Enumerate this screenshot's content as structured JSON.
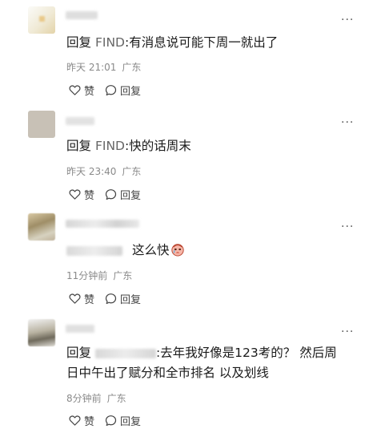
{
  "actions": {
    "like_label": "赞",
    "reply_label": "回复"
  },
  "comments": [
    {
      "reply_prefix": "回复",
      "reply_target": "FIND",
      "text": ":有消息说可能下周一就出了",
      "date": "昨天 21:01",
      "location": "广东"
    },
    {
      "reply_prefix": "回复",
      "reply_target": "FIND",
      "text": ":快的话周末",
      "date": "昨天 23:40",
      "location": "广东"
    },
    {
      "text": "这么快",
      "date": "11分钟前",
      "location": "广东"
    },
    {
      "reply_prefix": "回复",
      "text_line1": ":去年我好像是123考的？ 然后周",
      "text_line2": "日中午出了赋分和全市排名 以及划线",
      "date": "8分钟前",
      "location": "广东"
    }
  ],
  "colors": {
    "meta_gray": "#8a8a8a",
    "reply_target_gray": "#666666"
  }
}
